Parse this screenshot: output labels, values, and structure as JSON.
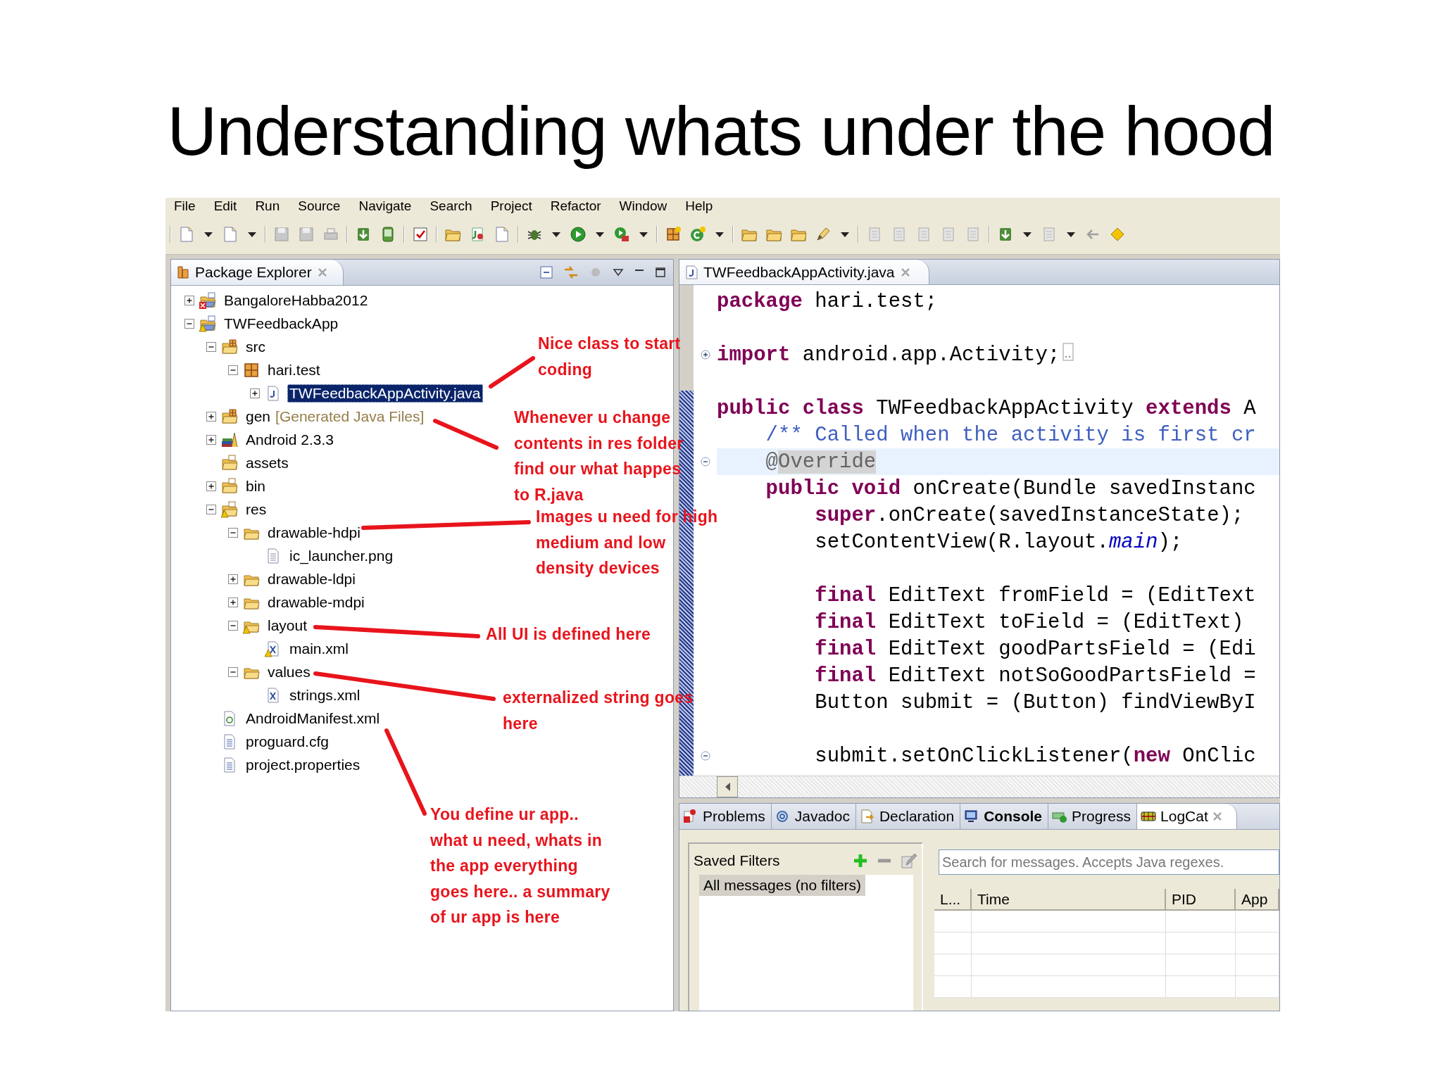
{
  "slide_title": "Understanding whats under the hood",
  "menu": [
    "File",
    "Edit",
    "Run",
    "Source",
    "Navigate",
    "Search",
    "Project",
    "Refactor",
    "Window",
    "Help"
  ],
  "package_explorer": {
    "title": "Package Explorer",
    "tree": [
      {
        "label": "BangaloreHabba2012",
        "kind": "project",
        "error": true,
        "expanded": false,
        "selected": false
      },
      {
        "label": "TWFeedbackApp",
        "kind": "project",
        "warning": true,
        "expanded": true,
        "selected": false,
        "children": [
          {
            "label": "src",
            "kind": "source-folder",
            "expanded": true,
            "selected": false,
            "children": [
              {
                "label": "hari.test",
                "kind": "package",
                "expanded": true,
                "selected": false,
                "children": [
                  {
                    "label": "TWFeedbackAppActivity.java",
                    "kind": "java-file",
                    "expanded": false,
                    "selected": true
                  }
                ]
              }
            ]
          },
          {
            "label": "gen",
            "decoration": "[Generated Java Files]",
            "kind": "source-folder",
            "expanded": false,
            "selected": false
          },
          {
            "label": "Android 2.3.3",
            "kind": "library",
            "expanded": false,
            "selected": false
          },
          {
            "label": "assets",
            "kind": "resource-folder",
            "selected": false
          },
          {
            "label": "bin",
            "kind": "resource-folder",
            "expanded": false,
            "selected": false
          },
          {
            "label": "res",
            "kind": "resource-folder",
            "warning": true,
            "expanded": true,
            "selected": false,
            "children": [
              {
                "label": "drawable-hdpi",
                "kind": "folder",
                "expanded": true,
                "selected": false,
                "children": [
                  {
                    "label": "ic_launcher.png",
                    "kind": "file",
                    "selected": false
                  }
                ]
              },
              {
                "label": "drawable-ldpi",
                "kind": "folder",
                "expanded": false,
                "selected": false
              },
              {
                "label": "drawable-mdpi",
                "kind": "folder",
                "expanded": false,
                "selected": false
              },
              {
                "label": "layout",
                "kind": "folder",
                "warning": true,
                "expanded": true,
                "selected": false,
                "children": [
                  {
                    "label": "main.xml",
                    "kind": "xml-file",
                    "warning": true,
                    "selected": false
                  }
                ]
              },
              {
                "label": "values",
                "kind": "folder",
                "expanded": true,
                "selected": false,
                "children": [
                  {
                    "label": "strings.xml",
                    "kind": "xml-file",
                    "selected": false
                  }
                ]
              }
            ]
          },
          {
            "label": "AndroidManifest.xml",
            "kind": "manifest-file",
            "selected": false
          },
          {
            "label": "proguard.cfg",
            "kind": "text-file",
            "selected": false
          },
          {
            "label": "project.properties",
            "kind": "text-file",
            "selected": false
          }
        ]
      }
    ]
  },
  "editor": {
    "tab": "TWFeedbackAppActivity.java",
    "lines": [
      {
        "current": false,
        "tokens": [
          {
            "kind": "keyword",
            "text": "package"
          },
          {
            "kind": "plain",
            "text": " hari.test;"
          }
        ]
      },
      {
        "current": false
      },
      {
        "current": false,
        "folded": true,
        "tokens": [
          {
            "kind": "keyword",
            "text": "import"
          },
          {
            "kind": "plain",
            "text": " android.app.Activity;"
          }
        ]
      },
      {
        "current": false
      },
      {
        "current": false,
        "tokens": [
          {
            "kind": "keyword",
            "text": "public class"
          },
          {
            "kind": "plain",
            "text": " TWFeedbackAppActivity "
          },
          {
            "kind": "keyword",
            "text": "extends"
          },
          {
            "kind": "plain",
            "text": " A"
          }
        ]
      },
      {
        "current": false,
        "tokens": [
          {
            "kind": "comment",
            "text": "    /** Called when the activity is first cr"
          }
        ]
      },
      {
        "current": true,
        "folded": false,
        "tokens": [
          {
            "kind": "annotation",
            "text": "    @"
          },
          {
            "kind": "occurrence",
            "text": "Override"
          }
        ]
      },
      {
        "current": false,
        "tokens": [
          {
            "kind": "keyword",
            "text": "    public void"
          },
          {
            "kind": "plain",
            "text": " onCreate(Bundle savedInstanc"
          }
        ]
      },
      {
        "current": false,
        "tokens": [
          {
            "kind": "keyword",
            "text": "        super"
          },
          {
            "kind": "plain",
            "text": ".onCreate(savedInstanceState);"
          }
        ]
      },
      {
        "current": false,
        "tokens": [
          {
            "kind": "plain",
            "text": "        setContentView(R.layout."
          },
          {
            "kind": "field",
            "text": "main"
          },
          {
            "kind": "plain",
            "text": ");"
          }
        ]
      },
      {
        "current": false
      },
      {
        "current": false,
        "tokens": [
          {
            "kind": "keyword",
            "text": "        final"
          },
          {
            "kind": "plain",
            "text": " EditText fromField = (EditText"
          }
        ]
      },
      {
        "current": false,
        "tokens": [
          {
            "kind": "keyword",
            "text": "        final"
          },
          {
            "kind": "plain",
            "text": " EditText toField = (EditText)"
          }
        ]
      },
      {
        "current": false,
        "tokens": [
          {
            "kind": "keyword",
            "text": "        final"
          },
          {
            "kind": "plain",
            "text": " EditText goodPartsField = (Edi"
          }
        ]
      },
      {
        "current": false,
        "tokens": [
          {
            "kind": "keyword",
            "text": "        final"
          },
          {
            "kind": "plain",
            "text": " EditText notSoGoodPartsField ="
          }
        ]
      },
      {
        "current": false,
        "tokens": [
          {
            "kind": "plain",
            "text": "        Button submit = (Button) findViewByI"
          }
        ]
      },
      {
        "current": false
      },
      {
        "current": false,
        "folded": false,
        "tokens": [
          {
            "kind": "plain",
            "text": "        submit.setOnClickListener("
          },
          {
            "kind": "keyword",
            "text": "new"
          },
          {
            "kind": "plain",
            "text": " OnClic"
          }
        ]
      }
    ]
  },
  "bottom_panel": {
    "tabs": [
      {
        "label": "Problems",
        "kind": "problems",
        "selected": false,
        "highlighted": false
      },
      {
        "label": "Javadoc",
        "kind": "javadoc",
        "selected": false,
        "highlighted": false
      },
      {
        "label": "Declaration",
        "kind": "declaration",
        "selected": false,
        "highlighted": false
      },
      {
        "label": "Console",
        "kind": "console",
        "selected": false,
        "highlighted": true
      },
      {
        "label": "Progress",
        "kind": "progress",
        "selected": false,
        "highlighted": false
      },
      {
        "label": "LogCat",
        "kind": "logcat",
        "selected": true,
        "highlighted": false
      }
    ],
    "saved_filters": {
      "title": "Saved Filters",
      "items": [
        {
          "label": "All messages (no filters)",
          "selected": true
        }
      ]
    },
    "search": {
      "placeholder": "Search for messages. Accepts Java regexes."
    },
    "columns": [
      "L...",
      "Time",
      "PID",
      "App"
    ]
  },
  "annotations": [
    {
      "text": "Nice class to start\ncoding"
    },
    {
      "text": "Whenever u change\ncontents in res folder\nfind our what happes\nto R.java"
    },
    {
      "text": "Images u need for high\nmedium and low\ndensity devices"
    },
    {
      "text": "All UI is defined here"
    },
    {
      "text": "externalized string goes\nhere"
    },
    {
      "text": "You define ur app..\nwhat u need, whats in\nthe app everything\ngoes here.. a summary\nof ur app is here"
    }
  ]
}
